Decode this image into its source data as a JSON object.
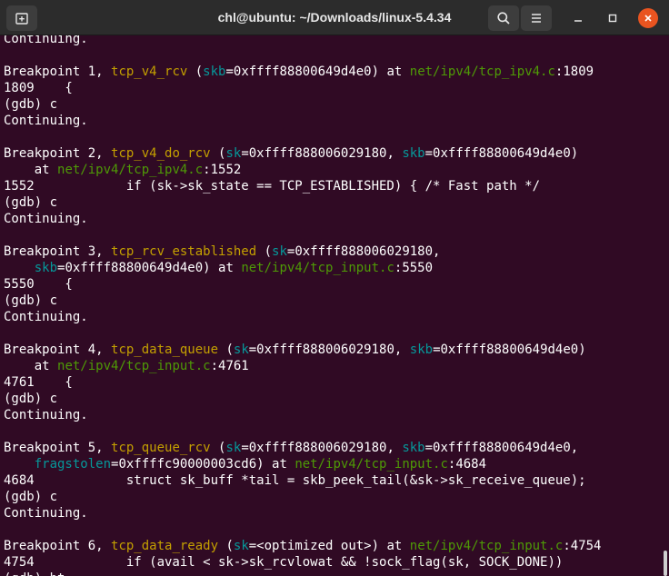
{
  "window": {
    "title": "chl@ubuntu: ~/Downloads/linux-5.4.34",
    "icons": [
      "new-tab-icon",
      "search-icon",
      "menu-icon",
      "minimize-icon",
      "maximize-icon",
      "close-icon"
    ]
  },
  "colors": {
    "background": "#300a24",
    "function": "#c4a000",
    "argument": "#06989a",
    "path": "#4e9a06",
    "text": "#ffffff",
    "close_button": "#e95420"
  },
  "terminal": {
    "lines": [
      [
        {
          "t": "Continuing."
        }
      ],
      [],
      [
        {
          "t": "Breakpoint 1, "
        },
        {
          "t": "tcp_v4_rcv",
          "c": "fn"
        },
        {
          "t": " ("
        },
        {
          "t": "skb",
          "c": "arg"
        },
        {
          "t": "=0xffff88800649d4e0) at "
        },
        {
          "t": "net/ipv4/tcp_ipv4.c",
          "c": "path"
        },
        {
          "t": ":1809"
        }
      ],
      [
        {
          "t": "1809\t{"
        }
      ],
      [
        {
          "t": "(gdb) c"
        }
      ],
      [
        {
          "t": "Continuing."
        }
      ],
      [],
      [
        {
          "t": "Breakpoint 2, "
        },
        {
          "t": "tcp_v4_do_rcv",
          "c": "fn"
        },
        {
          "t": " ("
        },
        {
          "t": "sk",
          "c": "arg"
        },
        {
          "t": "=0xffff888006029180, "
        },
        {
          "t": "skb",
          "c": "arg"
        },
        {
          "t": "=0xffff88800649d4e0)"
        }
      ],
      [
        {
          "t": "    at "
        },
        {
          "t": "net/ipv4/tcp_ipv4.c",
          "c": "path"
        },
        {
          "t": ":1552"
        }
      ],
      [
        {
          "t": "1552\t\tif (sk->sk_state == TCP_ESTABLISHED) { /* Fast path */"
        }
      ],
      [
        {
          "t": "(gdb) c"
        }
      ],
      [
        {
          "t": "Continuing."
        }
      ],
      [],
      [
        {
          "t": "Breakpoint 3, "
        },
        {
          "t": "tcp_rcv_established",
          "c": "fn"
        },
        {
          "t": " ("
        },
        {
          "t": "sk",
          "c": "arg"
        },
        {
          "t": "=0xffff888006029180, "
        }
      ],
      [
        {
          "t": "    "
        },
        {
          "t": "skb",
          "c": "arg"
        },
        {
          "t": "=0xffff88800649d4e0) at "
        },
        {
          "t": "net/ipv4/tcp_input.c",
          "c": "path"
        },
        {
          "t": ":5550"
        }
      ],
      [
        {
          "t": "5550\t{"
        }
      ],
      [
        {
          "t": "(gdb) c"
        }
      ],
      [
        {
          "t": "Continuing."
        }
      ],
      [],
      [
        {
          "t": "Breakpoint 4, "
        },
        {
          "t": "tcp_data_queue",
          "c": "fn"
        },
        {
          "t": " ("
        },
        {
          "t": "sk",
          "c": "arg"
        },
        {
          "t": "=0xffff888006029180, "
        },
        {
          "t": "skb",
          "c": "arg"
        },
        {
          "t": "=0xffff88800649d4e0)"
        }
      ],
      [
        {
          "t": "    at "
        },
        {
          "t": "net/ipv4/tcp_input.c",
          "c": "path"
        },
        {
          "t": ":4761"
        }
      ],
      [
        {
          "t": "4761\t{"
        }
      ],
      [
        {
          "t": "(gdb) c"
        }
      ],
      [
        {
          "t": "Continuing."
        }
      ],
      [],
      [
        {
          "t": "Breakpoint 5, "
        },
        {
          "t": "tcp_queue_rcv",
          "c": "fn"
        },
        {
          "t": " ("
        },
        {
          "t": "sk",
          "c": "arg"
        },
        {
          "t": "=0xffff888006029180, "
        },
        {
          "t": "skb",
          "c": "arg"
        },
        {
          "t": "=0xffff88800649d4e0, "
        }
      ],
      [
        {
          "t": "    "
        },
        {
          "t": "fragstolen",
          "c": "arg"
        },
        {
          "t": "=0xffffc90000003cd6) at "
        },
        {
          "t": "net/ipv4/tcp_input.c",
          "c": "path"
        },
        {
          "t": ":4684"
        }
      ],
      [
        {
          "t": "4684\t\tstruct sk_buff *tail = skb_peek_tail(&sk->sk_receive_queue);"
        }
      ],
      [
        {
          "t": "(gdb) c"
        }
      ],
      [
        {
          "t": "Continuing."
        }
      ],
      [],
      [
        {
          "t": "Breakpoint 6, "
        },
        {
          "t": "tcp_data_ready",
          "c": "fn"
        },
        {
          "t": " ("
        },
        {
          "t": "sk",
          "c": "arg"
        },
        {
          "t": "=<optimized out>) at "
        },
        {
          "t": "net/ipv4/tcp_input.c",
          "c": "path"
        },
        {
          "t": ":4754"
        }
      ],
      [
        {
          "t": "4754\t\tif (avail < sk->sk_rcvlowat && !sock_flag(sk, SOCK_DONE))"
        }
      ],
      [
        {
          "t": "(gdb) bt"
        }
      ]
    ]
  }
}
